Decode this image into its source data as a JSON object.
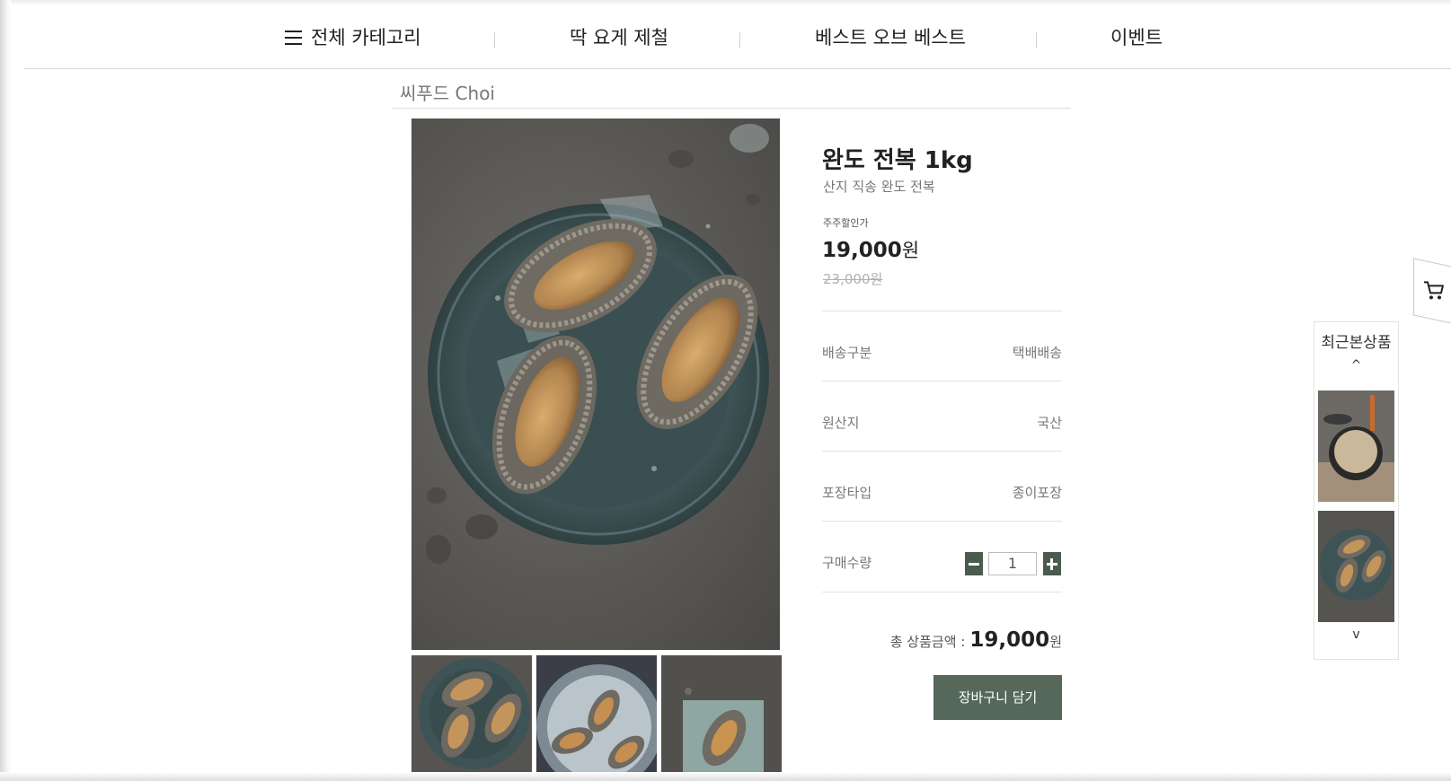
{
  "nav": {
    "items": [
      "전체 카테고리",
      "딱 요게 제철",
      "베스트 오브 베스트",
      "이벤트"
    ]
  },
  "breadcrumb": "씨푸드 Choi",
  "product": {
    "title": "완도 전복 1kg",
    "subtitle": "산지 직송 완도 전복",
    "price_label": "주주할인가",
    "price": "19,000",
    "price_unit": "원",
    "original_price": "23,000원",
    "specs": [
      {
        "key": "배송구분",
        "value": "택배배송"
      },
      {
        "key": "원산지",
        "value": "국산"
      },
      {
        "key": "포장타입",
        "value": "종이포장"
      }
    ],
    "quantity_label": "구매수량",
    "quantity": "1",
    "total_label": "총 상품금액 :",
    "total": "19,000",
    "total_unit": "원",
    "cart_button": "장바구니 담기"
  },
  "recent": {
    "title": "최근본상품",
    "up": "^",
    "down": "v"
  },
  "colors": {
    "accent": "#55685a",
    "qty_button": "#4a5b4d",
    "plate": "#3f5557",
    "background_stone": "#5a5855"
  },
  "icons": [
    "hamburger-icon",
    "cart-icon",
    "minus-icon",
    "plus-icon"
  ]
}
